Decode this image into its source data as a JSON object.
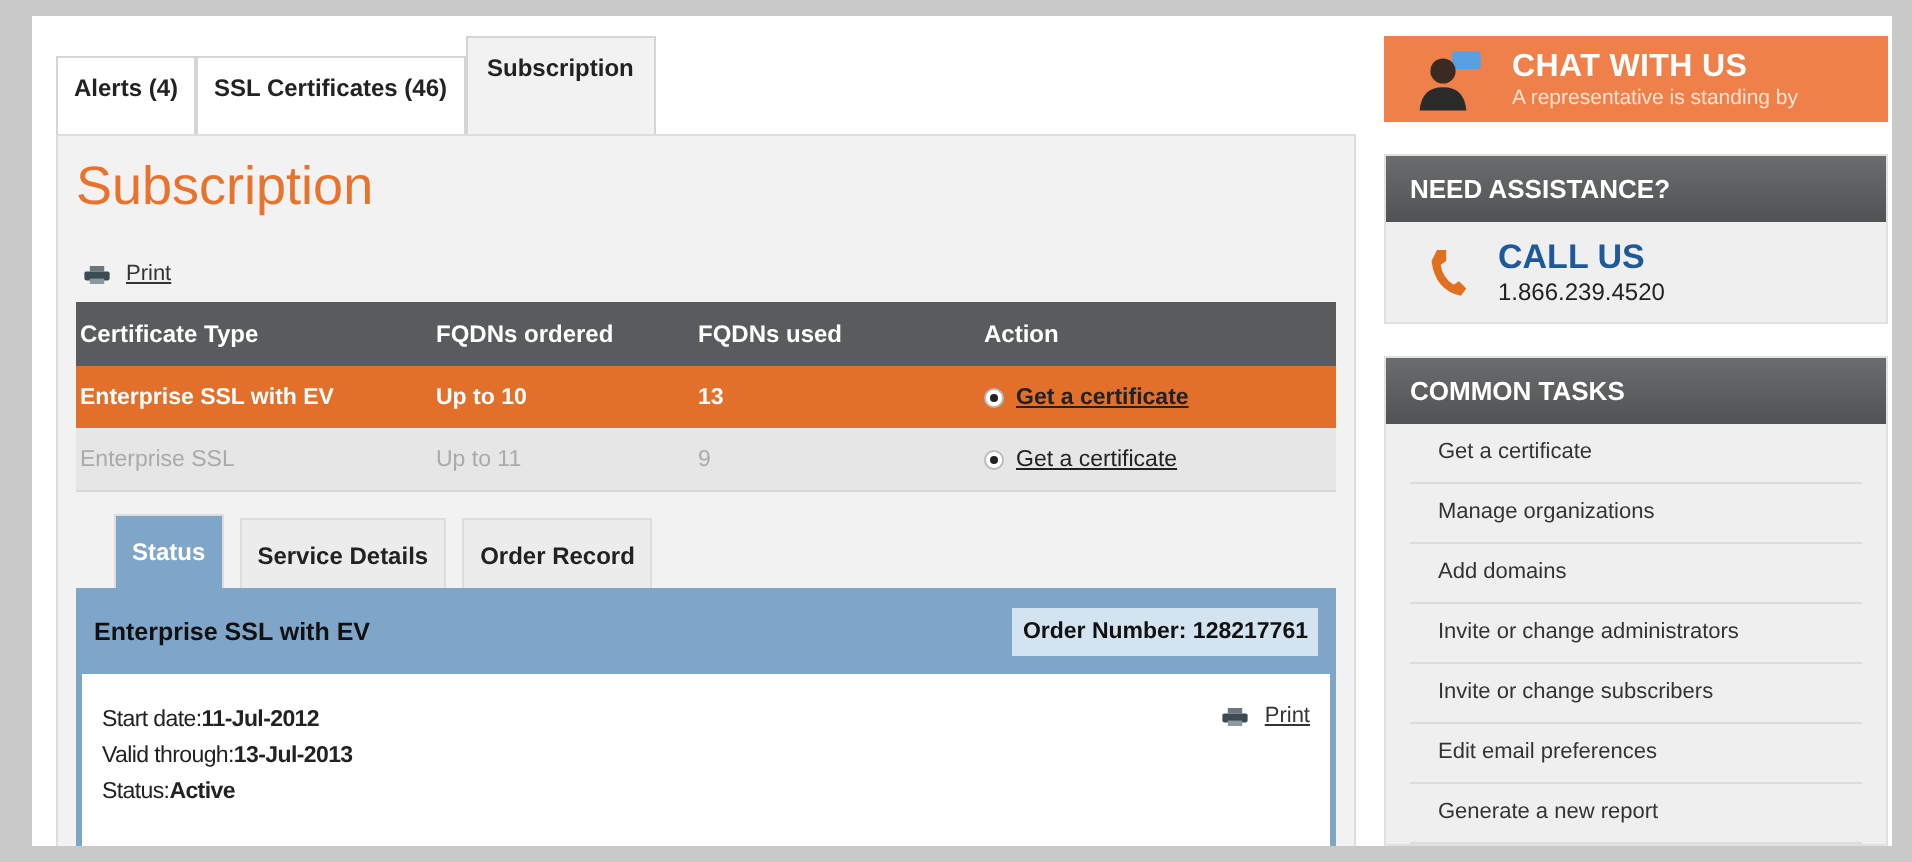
{
  "tabs": [
    {
      "label": "Alerts (4)",
      "selected": false
    },
    {
      "label": "SSL Certificates (46)",
      "selected": false
    },
    {
      "label": "Subscription",
      "selected": true
    }
  ],
  "title": "Subscription",
  "print_link": "Print",
  "table": {
    "columns": [
      "Certificate Type",
      "FQDNs ordered",
      "FQDNs used",
      "Action"
    ],
    "rows": [
      {
        "type": "Enterprise SSL with EV",
        "ordered": "Up to 10",
        "used": "13",
        "action": "Get a certificate",
        "selected": true
      },
      {
        "type": "Enterprise SSL",
        "ordered": "Up to 11",
        "used": "9",
        "action": "Get a certificate",
        "selected": false
      }
    ]
  },
  "detail_tabs": [
    {
      "label": "Status",
      "selected": true
    },
    {
      "label": "Service Details",
      "selected": false
    },
    {
      "label": "Order Record",
      "selected": false
    }
  ],
  "detail": {
    "product": "Enterprise SSL with EV",
    "order_number": "Order Number: 128217761",
    "print_link": "Print",
    "fields": [
      {
        "label": "Start date:",
        "value": "11-Jul-2012"
      },
      {
        "label": "Valid through:",
        "value": "13-Jul-2013"
      },
      {
        "label": "Status:",
        "value": "Active"
      }
    ]
  },
  "chat": {
    "title": "CHAT WITH US",
    "subtitle": "A representative is standing by"
  },
  "assistance": {
    "heading": "NEED ASSISTANCE?",
    "call": "CALL US",
    "phone": "1.866.239.4520"
  },
  "tasks": {
    "heading": "COMMON TASKS",
    "items": [
      "Get a certificate",
      "Manage organizations",
      "Add domains",
      "Invite or change administrators",
      "Invite or change subscribers",
      "Edit email preferences",
      "Generate a new report"
    ]
  }
}
